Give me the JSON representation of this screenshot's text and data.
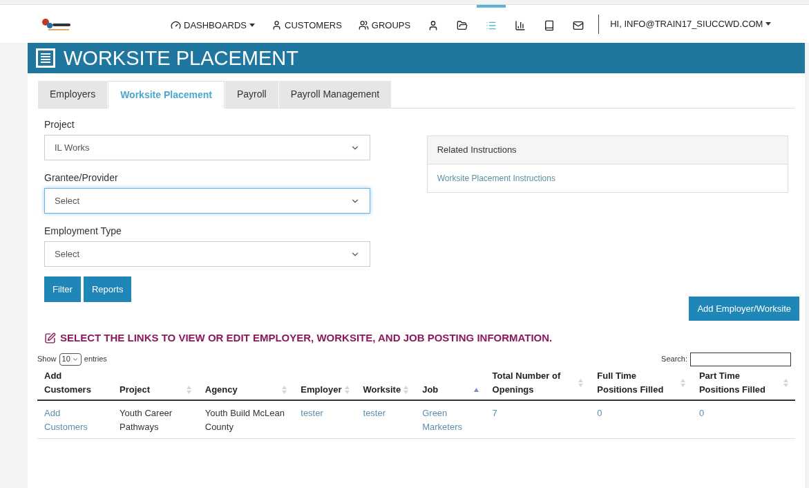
{
  "nav": {
    "items": [
      {
        "kind": "text",
        "label": "DASHBOARDS",
        "dropdown": true,
        "selected": false
      },
      {
        "kind": "text",
        "label": "CUSTOMERS",
        "dropdown": false,
        "selected": false
      },
      {
        "kind": "text",
        "label": "GROUPS",
        "dropdown": false,
        "selected": false
      },
      {
        "kind": "icon",
        "selected": false
      },
      {
        "kind": "icon",
        "selected": false
      },
      {
        "kind": "icon",
        "selected": true
      },
      {
        "kind": "icon",
        "selected": false
      },
      {
        "kind": "icon",
        "selected": false
      },
      {
        "kind": "icon",
        "selected": false
      }
    ],
    "user": {
      "label": "HI, INFO@TRAIN17_SIUCCWD.COM",
      "dropdown": true
    }
  },
  "header": {
    "title": "WORKSITE PLACEMENT"
  },
  "tabs": [
    {
      "label": "Employers",
      "selected": false
    },
    {
      "label": "Worksite Placement",
      "selected": true
    },
    {
      "label": "Payroll",
      "selected": false
    },
    {
      "label": "Payroll Management",
      "selected": false
    }
  ],
  "filters": [
    {
      "label": "Project",
      "value": "IL Works",
      "focused": false
    },
    {
      "label": "Grantee/Provider",
      "value": "Select",
      "focused": true
    },
    {
      "label": "Employment Type",
      "value": "Select",
      "focused": false
    }
  ],
  "buttons": [
    "Filter",
    "Reports"
  ],
  "related": {
    "title": "Related Instructions",
    "link": "Worksite Placement Instructions"
  },
  "add_button": "Add Employer/Worksite",
  "notice": "SELECT THE LINKS TO VIEW OR EDIT EMPLOYER, WORKSITE, AND JOB POSTING INFORMATION.",
  "table_controls": {
    "show_label": "Show",
    "page_size": "10",
    "entries_label": "entries",
    "search_label": "Search:"
  },
  "table": {
    "columns": [
      {
        "label": "Add Customers",
        "sortable": false
      },
      {
        "label": "Project",
        "sortable": true,
        "sorted": false
      },
      {
        "label": "Agency",
        "sortable": true,
        "sorted": false
      },
      {
        "label": "Employer",
        "sortable": true,
        "sorted": false
      },
      {
        "label": "Worksite",
        "sortable": true,
        "sorted": false
      },
      {
        "label": "Job",
        "sortable": true,
        "sorted": true
      },
      {
        "label": "Total Number of Openings",
        "sortable": true,
        "sorted": false
      },
      {
        "label": "Full Time Positions Filled",
        "sortable": true,
        "sorted": false
      },
      {
        "label": "Part Time Positions Filled",
        "sortable": true,
        "sorted": false
      }
    ],
    "rows": [
      {
        "cells": [
          {
            "text": "Add Customers",
            "link": true
          },
          {
            "text": "Youth Career Pathways",
            "link": false
          },
          {
            "text": "Youth Build McLean County",
            "link": false
          },
          {
            "text": "tester",
            "link": true
          },
          {
            "text": "tester",
            "link": true
          },
          {
            "text": "Green Marketers",
            "link": true
          },
          {
            "text": "7",
            "link": true
          },
          {
            "text": "0",
            "link": true
          },
          {
            "text": "0",
            "link": true
          }
        ]
      }
    ]
  }
}
